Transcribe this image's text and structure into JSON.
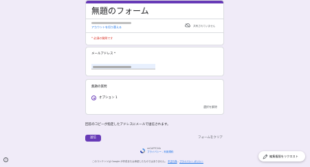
{
  "colors": {
    "page_background": "#f0ebf8",
    "accent": "#673ab7",
    "required": "#d93025",
    "link": "#1a73e8"
  },
  "form": {
    "title": "無題のフォーム",
    "switch_account": "アカウントを切り替える",
    "not_shared": "共有されていません",
    "required_note": "* 必須の質問です"
  },
  "email_question": {
    "label": "メールアドレス *"
  },
  "choice_question": {
    "label": "無題の質問",
    "options": [
      "オプション 1"
    ],
    "selected_index": 0,
    "clear_selection": "選択を解除"
  },
  "copy_note": "回答のコピーが指定したアドレスにメールで送信されます。",
  "actions": {
    "submit": "送信",
    "clear_form": "フォームをクリア"
  },
  "recaptcha": {
    "title": "reCAPTCHA",
    "links": "プライバシー - 利用規約"
  },
  "footer": {
    "text": "このコンテンツは Google が作成または承認したものではありません。",
    "report_link": "不正行為",
    "privacy_link": "プライバシー ポリシー"
  },
  "help": {
    "icon": "help-circle-icon",
    "glyph": "?"
  },
  "edit_request": {
    "label": "編集権限をリクエスト",
    "icon": "pencil-icon"
  }
}
